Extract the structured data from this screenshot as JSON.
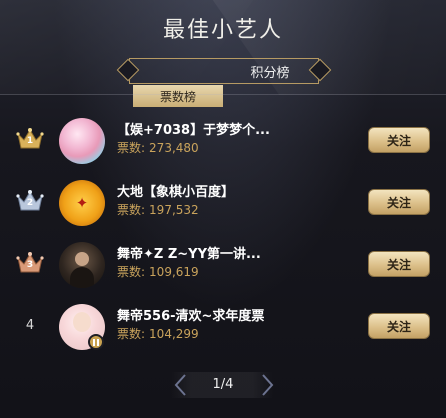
{
  "title": "最佳小艺人",
  "tabs": [
    {
      "label": "票数榜",
      "active": true
    },
    {
      "label": "积分榜",
      "active": false
    }
  ],
  "vote_label": "票数:",
  "follow_label": "关注",
  "entries": [
    {
      "rank": "1",
      "crown": "gold",
      "name": "【娱+7038】于梦梦个...",
      "votes": "273,480"
    },
    {
      "rank": "2",
      "crown": "silver",
      "name": "大地【象棋小百度】",
      "votes": "197,532"
    },
    {
      "rank": "3",
      "crown": "bronze",
      "name": "舞帝✦Z Z~YY第一讲...",
      "votes": "109,619"
    },
    {
      "rank": "4",
      "crown": "none",
      "name": "舞帝556-清欢~求年度票",
      "votes": "104,299"
    }
  ],
  "pagination": {
    "text": "1/4",
    "current": 1,
    "total": 4
  },
  "colors": {
    "gold": "#d9b15a",
    "silver": "#b9c7dc",
    "bronze": "#d99a78",
    "accent": "#c9a35c"
  }
}
